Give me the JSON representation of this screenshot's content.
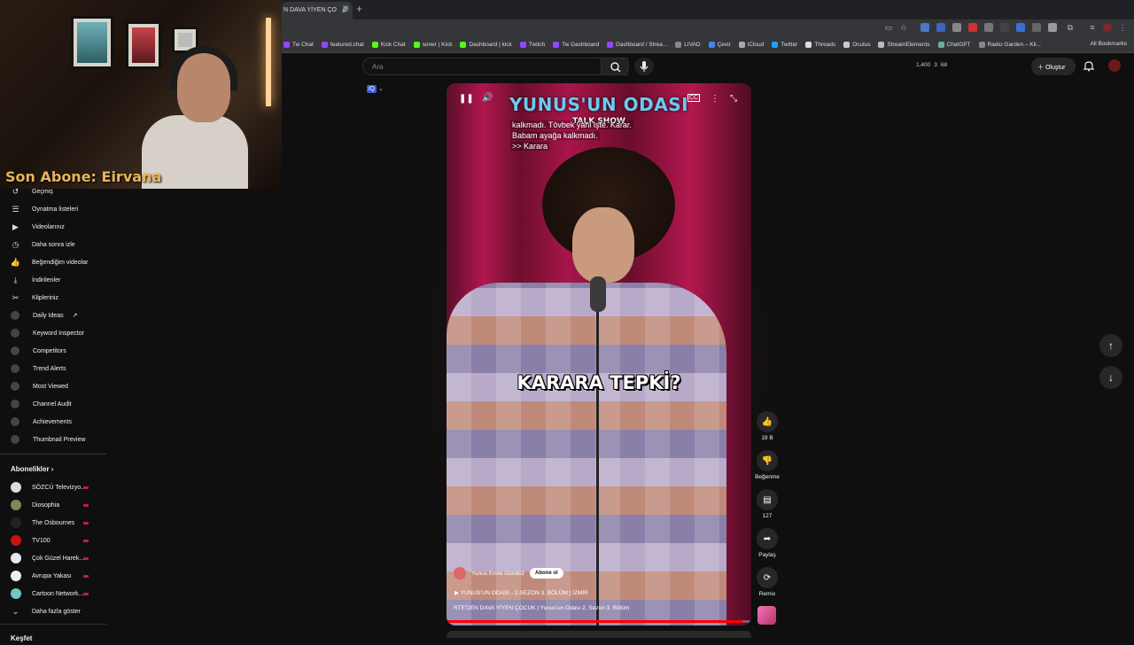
{
  "overlay": {
    "sub_label": "Son Abone: Eirvana"
  },
  "browser": {
    "tab_title": "N DAVA YİYEN ÇO",
    "bookmarks": [
      "Tw Chat",
      "featured.chat",
      "Kick Chat",
      "soner | Kick",
      "Dashboard | kick",
      "Twitch",
      "Tw Dashboard",
      "Dashboard / Strea...",
      "LIVAD",
      "Çevir",
      "iCloud",
      "Twitter",
      "Threads",
      "Oculus",
      "StreamElements",
      "ChatGPT",
      "Radio Garden – Kli..."
    ],
    "all_bookmarks": "All Bookmarks"
  },
  "header": {
    "search_placeholder": "Ara",
    "stats": [
      "1,400",
      "3",
      "68"
    ],
    "create_label": "Oluştur"
  },
  "sidebar": {
    "items": [
      {
        "label": "Geçmiş",
        "icon": "history-icon"
      },
      {
        "label": "Oynatma listeleri",
        "icon": "playlist-icon"
      },
      {
        "label": "Videolarınız",
        "icon": "video-icon"
      },
      {
        "label": "Daha sonra izle",
        "icon": "clock-icon"
      },
      {
        "label": "Beğendiğim videolar",
        "icon": "thumbs-up-icon"
      },
      {
        "label": "İndirilenler",
        "icon": "download-icon"
      },
      {
        "label": "Klipleriniz",
        "icon": "scissors-icon"
      },
      {
        "label": "Daily Ideas",
        "icon": "ext-icon"
      },
      {
        "label": "Keyword Inspector",
        "icon": "ext-icon"
      },
      {
        "label": "Competitors",
        "icon": "ext-icon"
      },
      {
        "label": "Trend Alerts",
        "icon": "ext-icon"
      },
      {
        "label": "Most Viewed",
        "icon": "ext-icon"
      },
      {
        "label": "Channel Audit",
        "icon": "ext-icon"
      },
      {
        "label": "Achievements",
        "icon": "ext-icon"
      },
      {
        "label": "Thumbnail Preview",
        "icon": "ext-icon"
      }
    ],
    "subs_title": "Abonelikler",
    "subscriptions": [
      {
        "label": "SÖZCÜ Televizyo...",
        "color": "#dddddd"
      },
      {
        "label": "Diosophia",
        "color": "#7a8a5a"
      },
      {
        "label": "The Osbournes",
        "color": "#222222"
      },
      {
        "label": "TV100",
        "color": "#cc1111"
      },
      {
        "label": "Çok Güzel Harek...",
        "color": "#e8e8e8"
      },
      {
        "label": "Avrupa Yakası",
        "color": "#f0f0f0"
      },
      {
        "label": "Cartoon Network...",
        "color": "#6fc7c9"
      }
    ],
    "show_more": "Daha fazla göster",
    "keşfet": "Keşfet"
  },
  "video": {
    "show_title": "YUNUS'UN ODASI",
    "show_subtitle": "TALK SHOW",
    "captions": [
      "kalkmadı. Tövbek yani işte. Karar.",
      "Babam ayağa kalkmadı.",
      ">> Karara"
    ],
    "big_caption": "KARARA TEPKİ?",
    "channel_name": "Yunus Emre Gündüz",
    "subscribe_label": "Abone ol",
    "playlist": "YUNUS'UN ODASI - 2.SEZON 3. BÖLÜM | İZMİR",
    "title": "RTE'DEN DAVA YİYEN ÇOCUK | Yunus'un Odası 2. Sezon 3. Bölüm",
    "progress": 0.97
  },
  "actions": {
    "likes": "19 B",
    "dislike_label": "Beğenme",
    "comments": "127",
    "share_label": "Paylaş",
    "remix_label": "Remix"
  }
}
